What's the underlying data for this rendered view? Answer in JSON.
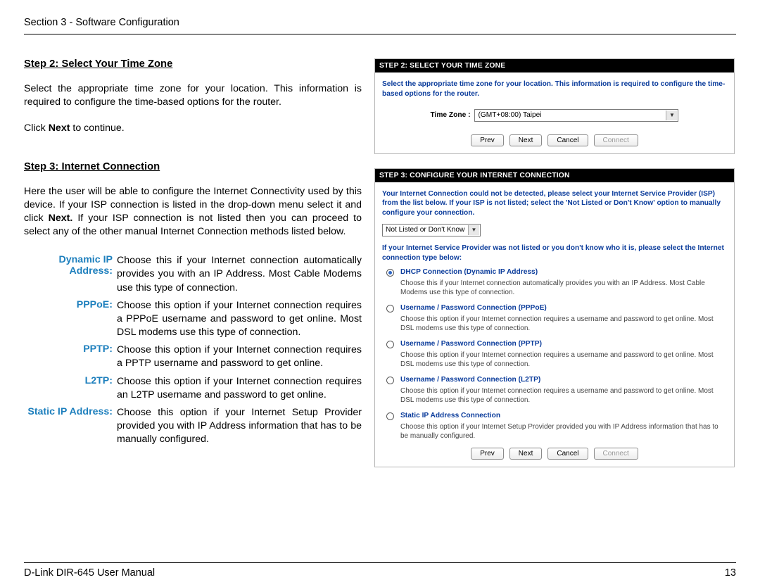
{
  "header_section": "Section 3 - Software Configuration",
  "step2": {
    "heading": "Step 2: Select Your Time Zone",
    "para": "Select the appropriate time zone for your location. This information is required to configure the time-based options for the router.",
    "click_next_pre": "Click ",
    "click_next_bold": "Next",
    "click_next_post": " to continue."
  },
  "step3": {
    "heading": "Step 3: Internet Connection",
    "para_pre": "Here the user will be able to configure the Internet Connectivity used by this device. If your ISP connection is listed in the drop-down menu select it and click ",
    "para_bold": "Next.",
    "para_post": " If your ISP connection is not listed then you can proceed to select any of the other manual Internet Connection methods listed below.",
    "defs": [
      {
        "term1": "Dynamic IP",
        "term2": "Address:",
        "desc": "Choose this if your Internet connection automatically provides you with an IP Address. Most Cable Modems use this type of connection."
      },
      {
        "term1": "PPPoE:",
        "term2": "",
        "desc": "Choose this option if your Internet connection requires a PPPoE username and password to get online. Most DSL modems use this type of connection."
      },
      {
        "term1": "PPTP:",
        "term2": "",
        "desc": "Choose this option if your Internet connection requires a PPTP username and password to get online."
      },
      {
        "term1": "L2TP:",
        "term2": "",
        "desc": "Choose this option if your Internet connection requires an L2TP username and password to get online."
      },
      {
        "term1": "Static IP Address:",
        "term2": "",
        "desc": "Choose this option if your Internet Setup Provider provided you with IP Address information that has to be manually configured."
      }
    ]
  },
  "panel2": {
    "header": "STEP 2: SELECT YOUR TIME ZONE",
    "instruction": "Select the appropriate time zone for your location. This information is required to configure the time-based options for the router.",
    "tz_label": "Time Zone  :",
    "tz_value": "(GMT+08:00) Taipei",
    "buttons": {
      "prev": "Prev",
      "next": "Next",
      "cancel": "Cancel",
      "connect": "Connect"
    }
  },
  "panel3": {
    "header": "STEP 3: CONFIGURE YOUR INTERNET CONNECTION",
    "instruction1": "Your Internet Connection could not be detected, please select your Internet Service Provider (ISP) from the list below. If your ISP is not listed; select the 'Not Listed or Don't Know' option to manually configure your connection.",
    "isp_value": "Not Listed or Don't Know",
    "instruction2": "If your Internet Service Provider was not listed or you don't know who it is, please select the Internet connection type below:",
    "options": [
      {
        "title": "DHCP Connection (Dynamic IP Address)",
        "desc": "Choose this if your Internet connection automatically provides you with an IP Address. Most Cable Modems use this type of connection.",
        "selected": true
      },
      {
        "title": "Username / Password Connection (PPPoE)",
        "desc": "Choose this option if your Internet connection requires a username and password to get online. Most DSL modems use this type of connection.",
        "selected": false
      },
      {
        "title": "Username / Password Connection (PPTP)",
        "desc": "Choose this option if your Internet connection requires a username and password to get online. Most DSL modems use this type of connection.",
        "selected": false
      },
      {
        "title": "Username / Password Connection (L2TP)",
        "desc": "Choose this option if your Internet connection requires a username and password to get online. Most DSL modems use this type of connection.",
        "selected": false
      },
      {
        "title": "Static IP Address Connection",
        "desc": "Choose this option if your Internet Setup Provider provided you with IP Address information that has to be manually configured.",
        "selected": false
      }
    ],
    "buttons": {
      "prev": "Prev",
      "next": "Next",
      "cancel": "Cancel",
      "connect": "Connect"
    }
  },
  "footer": {
    "left": "D-Link DIR-645 User Manual",
    "right": "13"
  }
}
